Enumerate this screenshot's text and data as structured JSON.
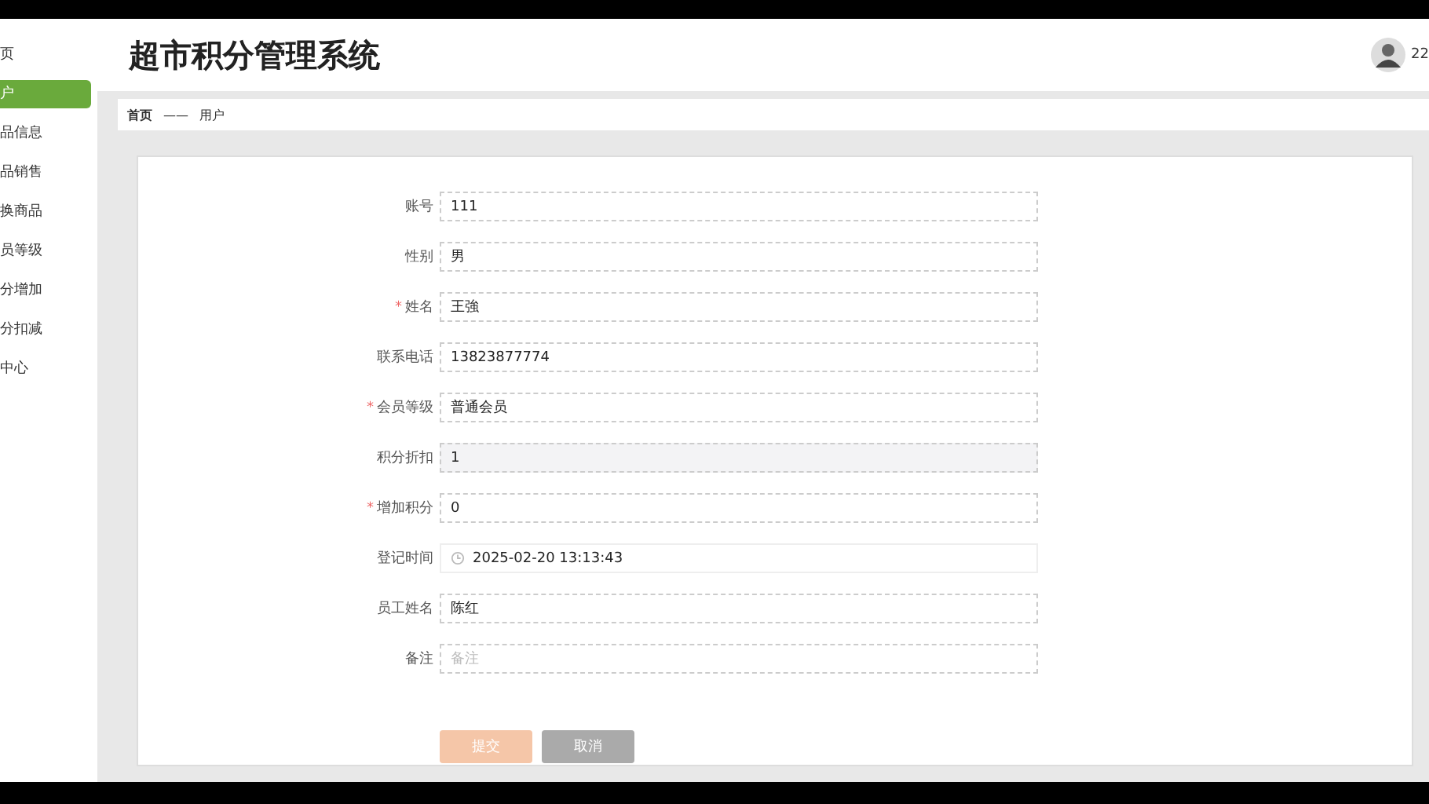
{
  "sidebar": {
    "items": [
      {
        "label": "页",
        "selected": false
      },
      {
        "label": "户",
        "selected": true
      },
      {
        "label": "品信息",
        "selected": false
      },
      {
        "label": "品销售",
        "selected": false
      },
      {
        "label": "换商品",
        "selected": false
      },
      {
        "label": "员等级",
        "selected": false
      },
      {
        "label": "分增加",
        "selected": false
      },
      {
        "label": "分扣减",
        "selected": false
      },
      {
        "label": "中心",
        "selected": false
      }
    ]
  },
  "header": {
    "title": "超市积分管理系统",
    "user": "22"
  },
  "breadcrumb": [
    "首页",
    "——",
    "用户"
  ],
  "form": {
    "required_mark": "*",
    "fields": [
      {
        "label": "账号",
        "kind": "text",
        "required": false,
        "value": "111"
      },
      {
        "label": "性别",
        "kind": "text",
        "required": false,
        "value": "男"
      },
      {
        "label": "姓名",
        "kind": "text",
        "required": true,
        "value": "王強"
      },
      {
        "label": "联系电话",
        "kind": "text",
        "required": false,
        "value": "13823877774"
      },
      {
        "label": "会员等级",
        "kind": "text",
        "required": true,
        "value": "普通会员"
      },
      {
        "label": "积分折扣",
        "kind": "disabled",
        "required": false,
        "value": "1"
      },
      {
        "label": "增加积分",
        "kind": "text",
        "required": true,
        "value": "0"
      },
      {
        "label": "登记时间",
        "kind": "date",
        "required": false,
        "value": "2025-02-20 13:13:43"
      },
      {
        "label": "员工姓名",
        "kind": "text",
        "required": false,
        "value": "陈红"
      },
      {
        "label": "备注",
        "kind": "text",
        "required": false,
        "placeholder": "备注"
      }
    ],
    "buttons": [
      {
        "label": "提交",
        "kind": "submit"
      },
      {
        "label": "取消",
        "kind": "cancel"
      }
    ]
  }
}
